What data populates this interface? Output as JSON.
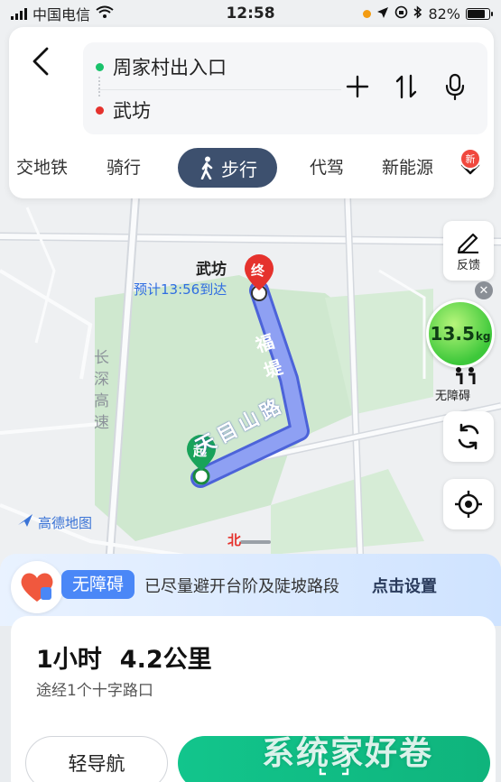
{
  "status_bar": {
    "carrier": "中国电信",
    "time": "12:58",
    "battery": "82%",
    "battery_level": 0.82
  },
  "route": {
    "start": "周家村出入口",
    "end": "武坊",
    "start_color": "#19c26b",
    "end_color": "#e5322d"
  },
  "modes": {
    "items": [
      "交地铁",
      "骑行",
      "步行",
      "代驾",
      "新能源"
    ],
    "active": "步行",
    "new_badge": "新"
  },
  "map": {
    "destination_label": "武坊",
    "eta": "预计13:56到达",
    "end_marker": "终",
    "start_marker": "起",
    "road_futi": "福堤",
    "road_tianmu": "天目山路",
    "expressway": "长深高速",
    "north": "北",
    "logo": "高德地图",
    "route_color": "#7b8ff0"
  },
  "side": {
    "feedback": "反馈",
    "carbon_value": "13.5",
    "carbon_unit": "kg",
    "accessible": "无障碍"
  },
  "sheet": {
    "access_badge": "无障碍",
    "access_text": "已尽量避开台阶及陡坡路段",
    "access_link": "点击设置",
    "duration": "1小时",
    "distance": "4.2公里",
    "via": "途经1个十字路口",
    "light_nav": "轻导航"
  },
  "watermark": "系统家好卷"
}
